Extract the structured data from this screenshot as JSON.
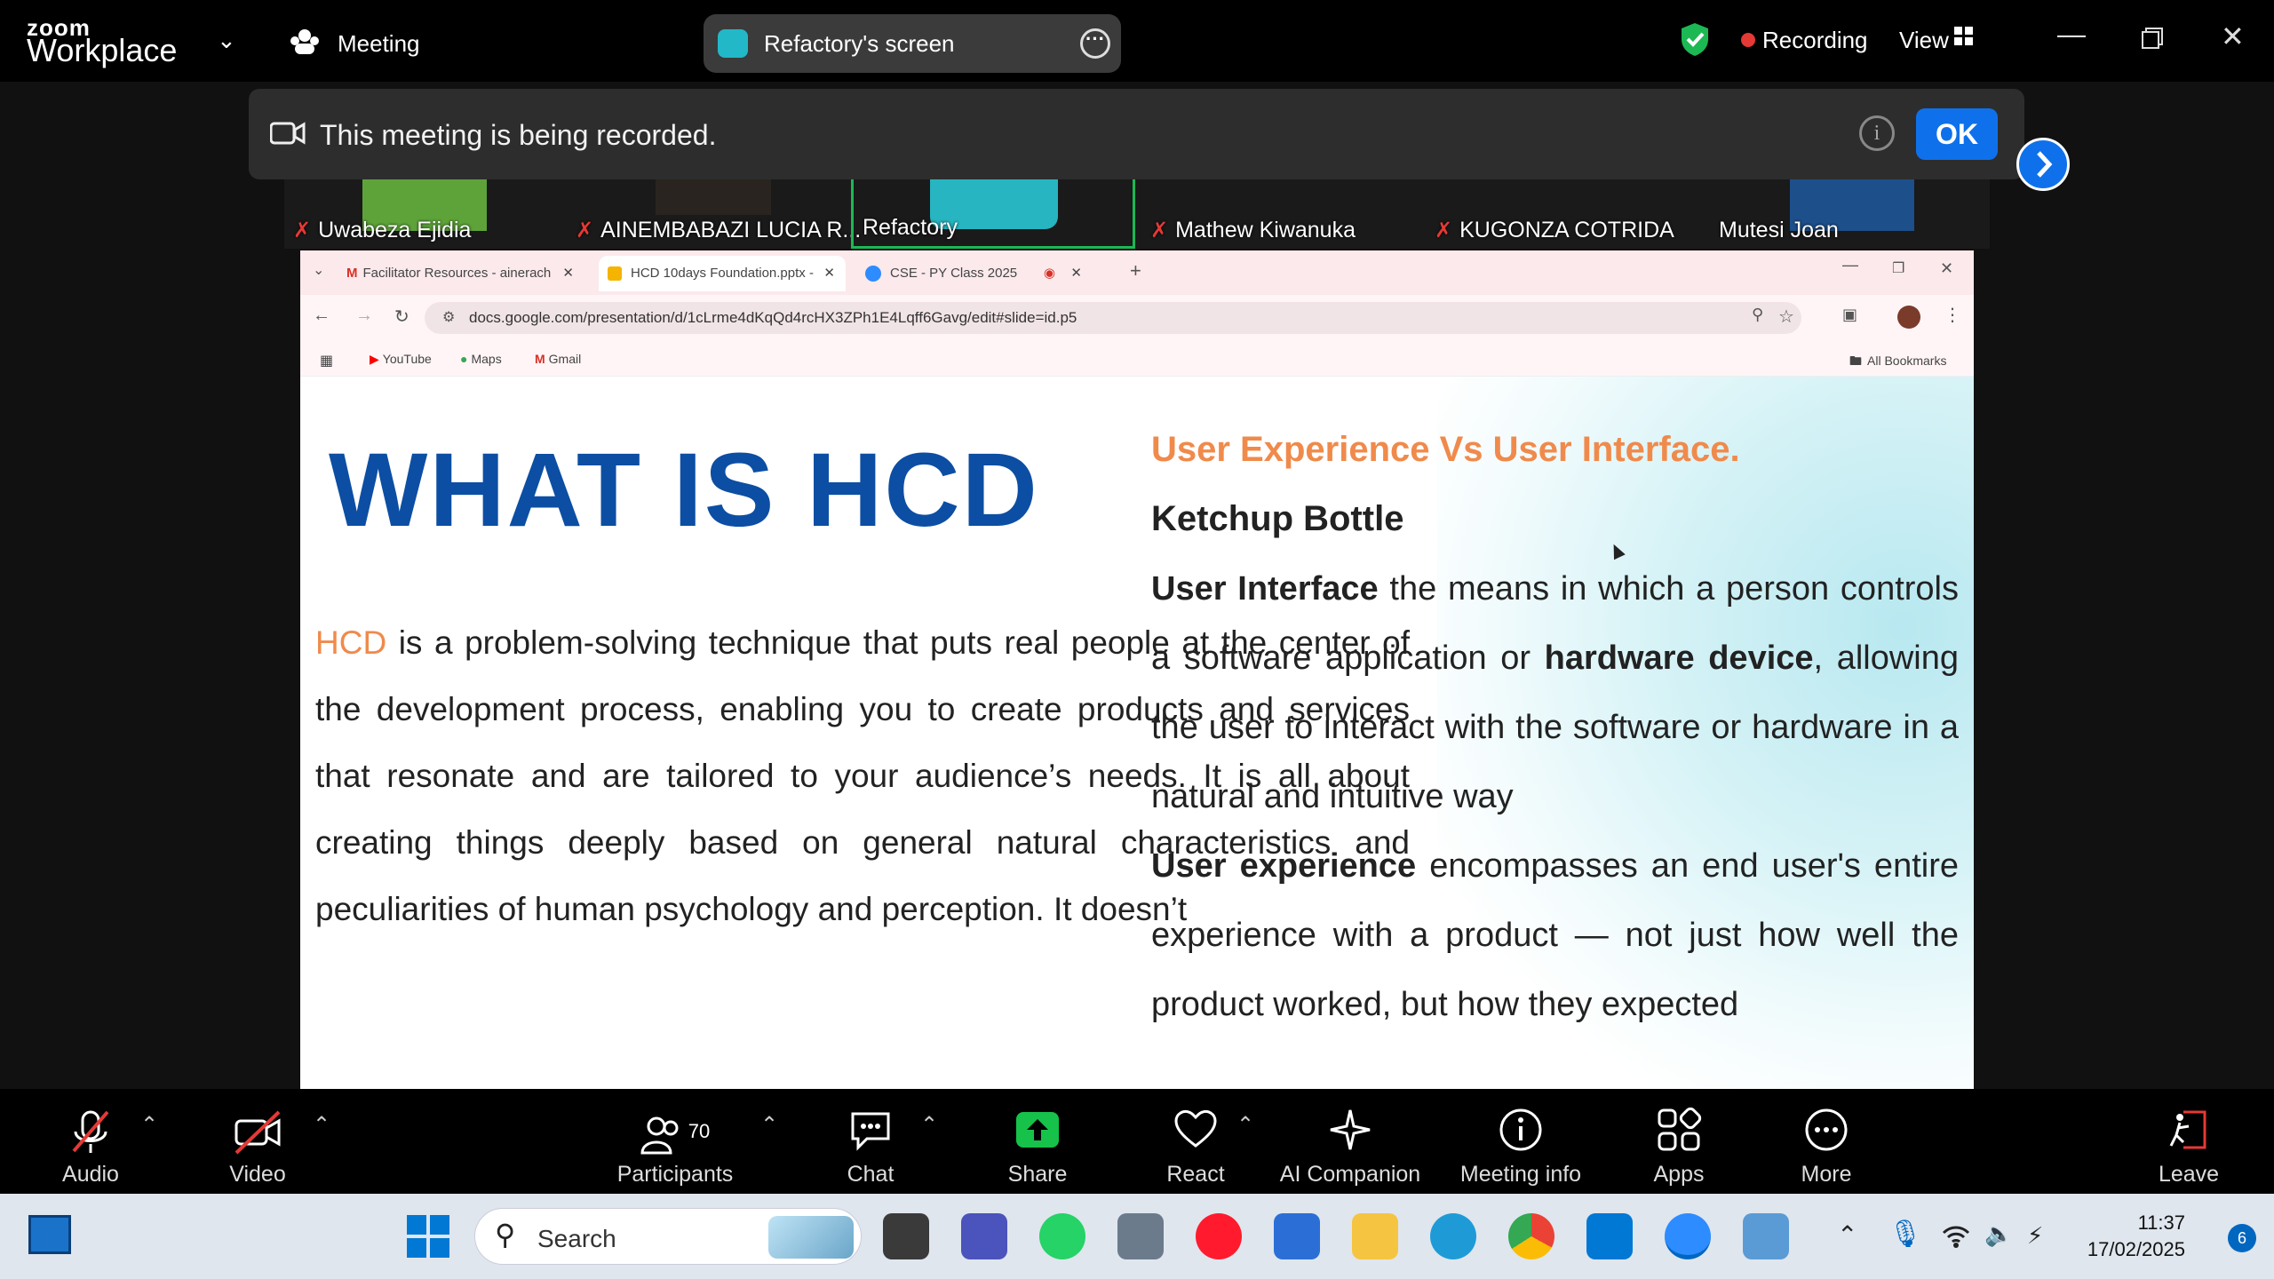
{
  "zoom": {
    "brand_small": "zoom",
    "brand_big": "Workplace",
    "meeting_label": "Meeting",
    "screen_share_label": "Refactory's screen",
    "recording_label": "Recording",
    "view_label": "View"
  },
  "banner": {
    "text": "This meeting is being recorded.",
    "ok": "OK"
  },
  "participants": [
    {
      "name": "Uwabeza Ejidia",
      "muted": true
    },
    {
      "name": "AINEMBABAZI LUCIA R...",
      "muted": true
    },
    {
      "name": "Refactory",
      "muted": false
    },
    {
      "name": "Mathew Kiwanuka",
      "muted": true
    },
    {
      "name": "KUGONZA COTRIDA",
      "muted": true
    },
    {
      "name": "Mutesi Joan",
      "muted": false
    }
  ],
  "browser": {
    "tabs": [
      {
        "label": "Facilitator Resources - ainerach"
      },
      {
        "label": "HCD 10days Foundation.pptx -"
      },
      {
        "label": "CSE - PY Class 2025"
      }
    ],
    "new_tab": "+",
    "url": "docs.google.com/presentation/d/1cLrme4dKqQd4rcHX3ZPh1E4Lqff6Gavg/edit#slide=id.p5",
    "bookmarks": [
      "YouTube",
      "Maps",
      "Gmail"
    ],
    "all_bookmarks": "All Bookmarks"
  },
  "slide": {
    "title": "WHAT IS HCD",
    "left_highlight": "HCD",
    "left_text": " is a problem-solving technique that puts real people at the center of the development process, enabling you to create products and services that resonate and are tailored to your audience’s needs. It is all about creating things deeply based on general natural characteristics and peculiarities of human psychology and perception. It doesn’t",
    "right_heading": "User Experience Vs User Interface.",
    "right_subheading": "Ketchup Bottle",
    "ui_term": "User Interface",
    "ui_text_1": " the means in which a person controls a software application or ",
    "ui_term_2": "hardware device",
    "ui_text_2": ", allowing the user to interact with the software or hardware in a natural and intuitive way",
    "ux_term": "User experience",
    "ux_text": " encompasses an end user's entire experience with a product — not just how well the product worked, but how they expected"
  },
  "toolbar": {
    "audio": "Audio",
    "video": "Video",
    "participants": "Participants",
    "participants_count": "70",
    "chat": "Chat",
    "share": "Share",
    "react": "React",
    "ai_companion": "AI Companion",
    "meeting_info": "Meeting info",
    "apps": "Apps",
    "more": "More",
    "leave": "Leave"
  },
  "taskbar": {
    "search": "Search",
    "time": "11:37",
    "date": "17/02/2025",
    "notifications": "6"
  },
  "colors": {
    "zoom_blue": "#0e71eb",
    "slide_title": "#0c4ea3",
    "slide_accent": "#f08a4b",
    "share_green": "#16c24a",
    "recording_red": "#e53935"
  }
}
